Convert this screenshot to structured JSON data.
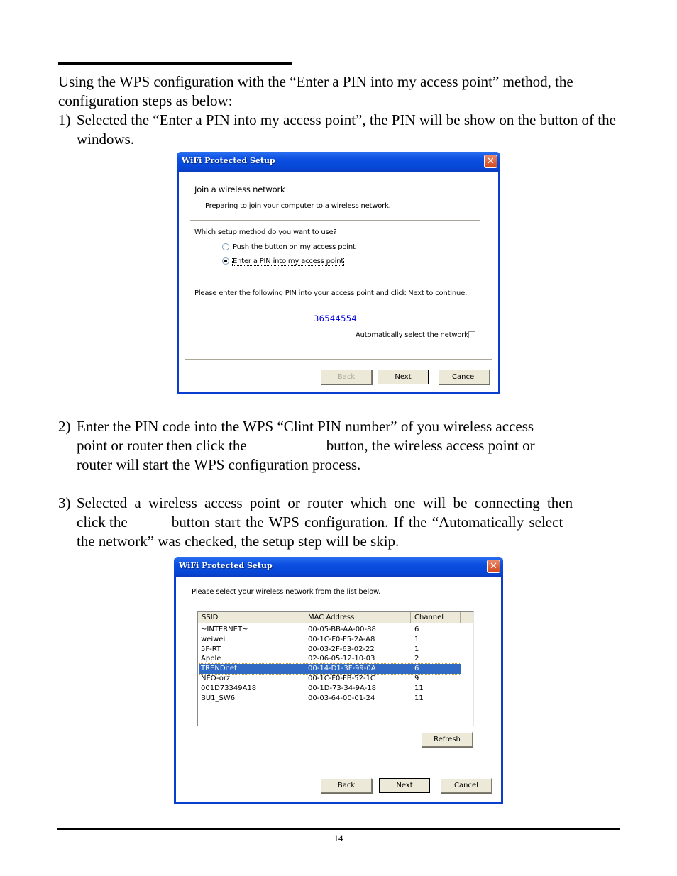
{
  "document": {
    "intro": "Using the WPS configuration with the “Enter a PIN into my access point” method, the configuration steps as below:",
    "steps": [
      {
        "num": "1)",
        "text": "Selected the “Enter a PIN into my access point”, the PIN will be show on the button of the windows."
      },
      {
        "num": "2)",
        "line1": "Enter the PIN code into the WPS “Clint PIN number” of you wireless access",
        "line2a": "point or router then click the",
        "line2b": "button, the wireless access point or",
        "line3": "router will start the WPS configuration process."
      },
      {
        "num": "3)",
        "line1": "Selected a wireless access point or router which one will be connecting then",
        "line2a": "click the",
        "line2b": "button start the WPS configuration. If the “Automatically select",
        "line3": "the network” was checked, the setup step will be skip."
      }
    ],
    "page_number": "14"
  },
  "dialog1": {
    "title": "WiFi Protected Setup",
    "close_icon": "close-x",
    "heading": "Join a wireless network",
    "subheading": "Preparing to join your computer to a wireless network.",
    "question": "Which setup method do you want to use?",
    "options": [
      {
        "label": "Push the button on my access point",
        "selected": false
      },
      {
        "label": "Enter a PIN into my access point",
        "selected": true
      }
    ],
    "instruction": "Please enter the following PIN into your access point and click Next to continue.",
    "pin": "36544554",
    "auto_select_label": "Automatically select the network",
    "auto_select_checked": false,
    "buttons": {
      "back": "Back",
      "next": "Next",
      "cancel": "Cancel"
    },
    "back_disabled": true
  },
  "dialog2": {
    "title": "WiFi Protected Setup",
    "close_icon": "close-x",
    "prompt": "Please select your wireless network from the list below.",
    "columns": [
      "SSID",
      "MAC Address",
      "Channel"
    ],
    "networks": [
      {
        "ssid": "~INTERNET~",
        "mac": "00-05-BB-AA-00-88",
        "channel": "6",
        "selected": false
      },
      {
        "ssid": "weiwei",
        "mac": "00-1C-F0-F5-2A-A8",
        "channel": "1",
        "selected": false
      },
      {
        "ssid": "5F-RT",
        "mac": "00-03-2F-63-02-22",
        "channel": "1",
        "selected": false
      },
      {
        "ssid": "Apple",
        "mac": "02-06-05-12-10-03",
        "channel": "2",
        "selected": false
      },
      {
        "ssid": "TRENDnet",
        "mac": "00-14-D1-3F-99-0A",
        "channel": "6",
        "selected": true
      },
      {
        "ssid": "NEO-orz",
        "mac": "00-1C-F0-FB-52-1C",
        "channel": "9",
        "selected": false
      },
      {
        "ssid": "001D73349A18",
        "mac": "00-1D-73-34-9A-18",
        "channel": "11",
        "selected": false
      },
      {
        "ssid": "BU1_SW6",
        "mac": "00-03-64-00-01-24",
        "channel": "11",
        "selected": false
      }
    ],
    "buttons": {
      "refresh": "Refresh",
      "back": "Back",
      "next": "Next",
      "cancel": "Cancel"
    },
    "selection_color": "#316ac5"
  }
}
